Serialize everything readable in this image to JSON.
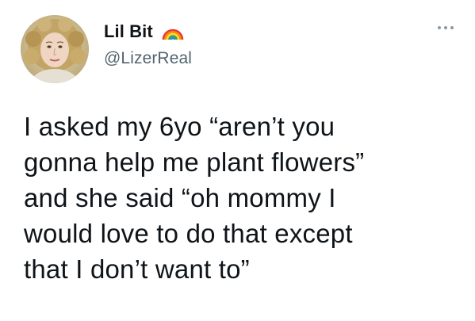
{
  "author": {
    "display_name": "Lil Bit",
    "handle": "@LizerReal",
    "badge_icon": "rainbow-icon",
    "avatar_icon": "profile-photo"
  },
  "menu": {
    "icon": "more-options-icon"
  },
  "tweet": {
    "lines": [
      "I asked my 6yo “aren’t you",
      "gonna help me plant flowers”",
      "and she said “oh mommy I",
      "would love to do that except",
      "that I don’t want to”"
    ]
  },
  "colors": {
    "text": "#0f1419",
    "secondary_text": "#536471",
    "background": "#ffffff",
    "rainbow": [
      "#e53935",
      "#fb8c00",
      "#fdd835",
      "#43a047",
      "#1e88e5",
      "#8e24aa"
    ]
  }
}
